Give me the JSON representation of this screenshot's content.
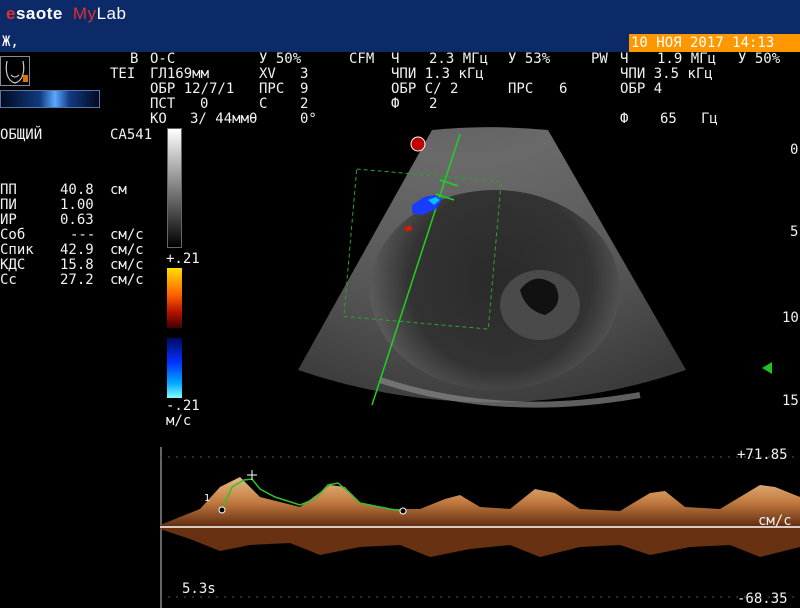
{
  "header": {
    "brand_e": "e",
    "brand_saote": "saote",
    "brand_my": "My",
    "brand_lab": "Lab",
    "patient": "Ж,",
    "datetime": "10 НОЯ 2017 14:13"
  },
  "params": {
    "row1": {
      "b": "B",
      "b_mode": "О-С",
      "b_gain": "У 50%",
      "cfm": "CFM",
      "cfm_mode": "Ч",
      "cfm_freq": "2.3 МГц",
      "cfm_gain": "У 53%",
      "pw": "PW",
      "pw_mode": "Ч",
      "pw_freq": "1.9 МГц",
      "pw_gain": "У 50%"
    },
    "row2": {
      "tei": "TEI",
      "depth": "ГЛ169мм",
      "xv": "XV",
      "xv_val": "3",
      "cfm_prf": "ЧПИ 1.3 кГц",
      "pw_prf": "ЧПИ 3.5 кГц"
    },
    "row3": {
      "obr": "ОБР 12/7/1",
      "prs": "ПРС",
      "prs_val": "9",
      "cfm_obr": "ОБР С/ 2",
      "cfm_prs": "ПРС",
      "cfm_prs_val": "6",
      "pw_obr": "ОБР 4"
    },
    "row4": {
      "pst": "ПСТ",
      "pst_val": "0",
      "c": "С",
      "c_val": "2",
      "phi": "Ф",
      "phi_val": "2"
    },
    "row5": {
      "ko": "КО",
      "ko_val": "3/ 44ммθ",
      "angle": "0°",
      "pw_phi": "Ф",
      "pw_phi_val": "65",
      "pw_phi_unit": "Гц"
    }
  },
  "probe": {
    "icon": "probe-position-icon"
  },
  "exam": {
    "name": "ОБЩИЙ",
    "probe_model": "CA541"
  },
  "measurements": [
    {
      "label": "ПП",
      "value": "40.8",
      "unit": "см"
    },
    {
      "label": "ПИ",
      "value": "1.00",
      "unit": ""
    },
    {
      "label": "ИР",
      "value": "0.63",
      "unit": ""
    },
    {
      "label": "Соб",
      "value": "---",
      "unit": "см/с"
    },
    {
      "label": "Спик",
      "value": "42.9",
      "unit": "см/с"
    },
    {
      "label": "КДС",
      "value": "15.8",
      "unit": "см/с"
    },
    {
      "label": "Сс",
      "value": "27.2",
      "unit": "см/с"
    }
  ],
  "color_scale": {
    "top": "+.21",
    "bottom": "-.21",
    "unit": "м/с"
  },
  "depth_scale": [
    "0",
    "5",
    "10",
    "15"
  ],
  "doppler": {
    "vmax": "+71.85",
    "vmin": "-68.35",
    "unit": "см/с",
    "sweep": "5.3s",
    "cycle_marker": "1"
  },
  "colors": {
    "header_bg": "#0c2a68",
    "datetime_bg": "#ff9800",
    "spectrum": "#e0a060",
    "trace": "#30c030",
    "needle": "#20d020"
  }
}
